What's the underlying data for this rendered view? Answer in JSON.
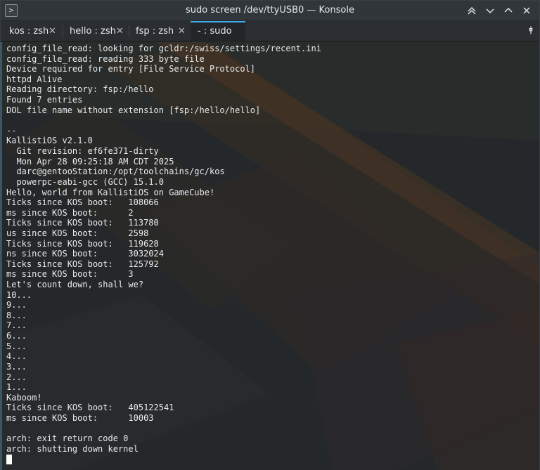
{
  "window": {
    "title": "sudo screen /dev/ttyUSB0 — Konsole",
    "icon": "konsole-icon",
    "controls": [
      "keep-above-icon",
      "minimize-icon",
      "maximize-icon",
      "close-icon"
    ]
  },
  "tabs": [
    {
      "label": "kos : zsh",
      "active": false
    },
    {
      "label": "hello : zsh",
      "active": false
    },
    {
      "label": "fsp : zsh",
      "active": false
    },
    {
      "label": "- : sudo",
      "active": true
    }
  ],
  "tab_menu_icon": "pin-icon",
  "terminal": {
    "lines": [
      "config_file_read: looking for gcldr:/swiss/settings/recent.ini",
      "config_file_read: reading 333 byte file",
      "Device required for entry [File Service Protocol]",
      "httpd Alive",
      "Reading directory: fsp:/hello",
      "Found 7 entries",
      "DOL file name without extension [fsp:/hello/hello]",
      "",
      "--",
      "KallistiOS v2.1.0",
      "  Git revision: ef6fe371-dirty",
      "  Mon Apr 28 09:25:18 AM CDT 2025",
      "  darc@gentooStation:/opt/toolchains/gc/kos",
      "  powerpc-eabi-gcc (GCC) 15.1.0",
      "Hello, world from KallistiOS on GameCube!",
      "Ticks since KOS boot:   108066",
      "ms since KOS boot:      2",
      "Ticks since KOS boot:   113780",
      "us since KOS boot:      2598",
      "Ticks since KOS boot:   119628",
      "ns since KOS boot:      3032024",
      "Ticks since KOS boot:   125792",
      "ms since KOS boot:      3",
      "Let's count down, shall we?",
      "10...",
      "9...",
      "8...",
      "7...",
      "6...",
      "5...",
      "4...",
      "3...",
      "2...",
      "1...",
      "Kaboom!",
      "Ticks since KOS boot:   405122541",
      "ms since KOS boot:      10003",
      "",
      "arch: exit return code 0",
      "arch: shutting down kernel"
    ]
  },
  "colors": {
    "accent": "#3daee9",
    "background": "#232627",
    "foreground": "#e8ebee"
  }
}
